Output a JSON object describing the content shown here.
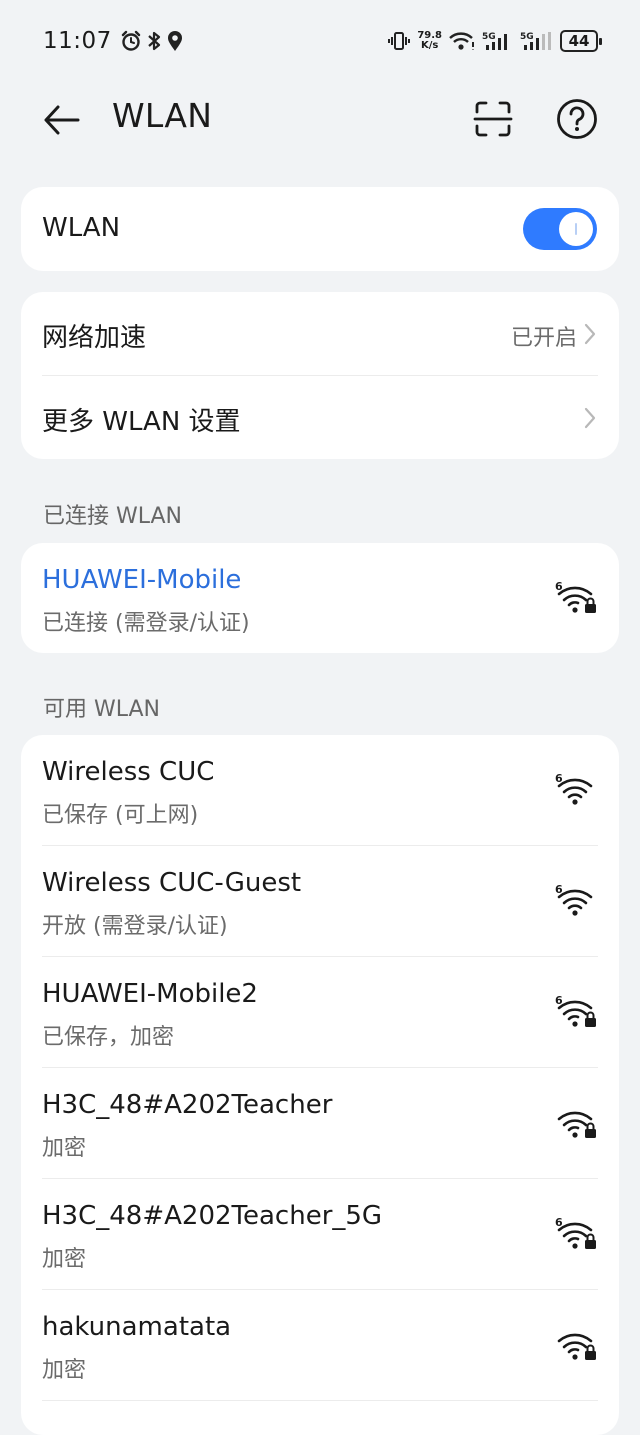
{
  "status_bar": {
    "time": "11:07",
    "net_speed_value": "79.8",
    "net_speed_unit": "K/s",
    "signal1_label": "5G",
    "signal2_label": "5G",
    "battery": "44"
  },
  "app_bar": {
    "title": "WLAN"
  },
  "wlan_toggle": {
    "label": "WLAN",
    "enabled": true
  },
  "settings": {
    "network_boost": {
      "label": "网络加速",
      "value": "已开启"
    },
    "more_settings": {
      "label": "更多 WLAN 设置"
    }
  },
  "connected_section": {
    "header": "已连接 WLAN",
    "network": {
      "name": "HUAWEI-Mobile",
      "status": "已连接 (需登录/认证)"
    }
  },
  "available_section": {
    "header": "可用 WLAN",
    "networks": [
      {
        "name": "Wireless CUC",
        "status": "已保存 (可上网)"
      },
      {
        "name": "Wireless CUC-Guest",
        "status": "开放 (需登录/认证)"
      },
      {
        "name": "HUAWEI-Mobile2",
        "status": "已保存，加密"
      },
      {
        "name": "H3C_48#A202Teacher",
        "status": "加密"
      },
      {
        "name": "H3C_48#A202Teacher_5G",
        "status": "加密"
      },
      {
        "name": "hakunamatata",
        "status": "加密"
      }
    ]
  },
  "colors": {
    "accent": "#2f7bff",
    "connected_text": "#2c6fdc",
    "background": "#f1f3f5",
    "card": "#ffffff"
  },
  "icons": {
    "wifi_6_lock": "wifi-6-lock-icon",
    "wifi_6": "wifi-6-icon",
    "wifi_lock": "wifi-lock-icon"
  }
}
